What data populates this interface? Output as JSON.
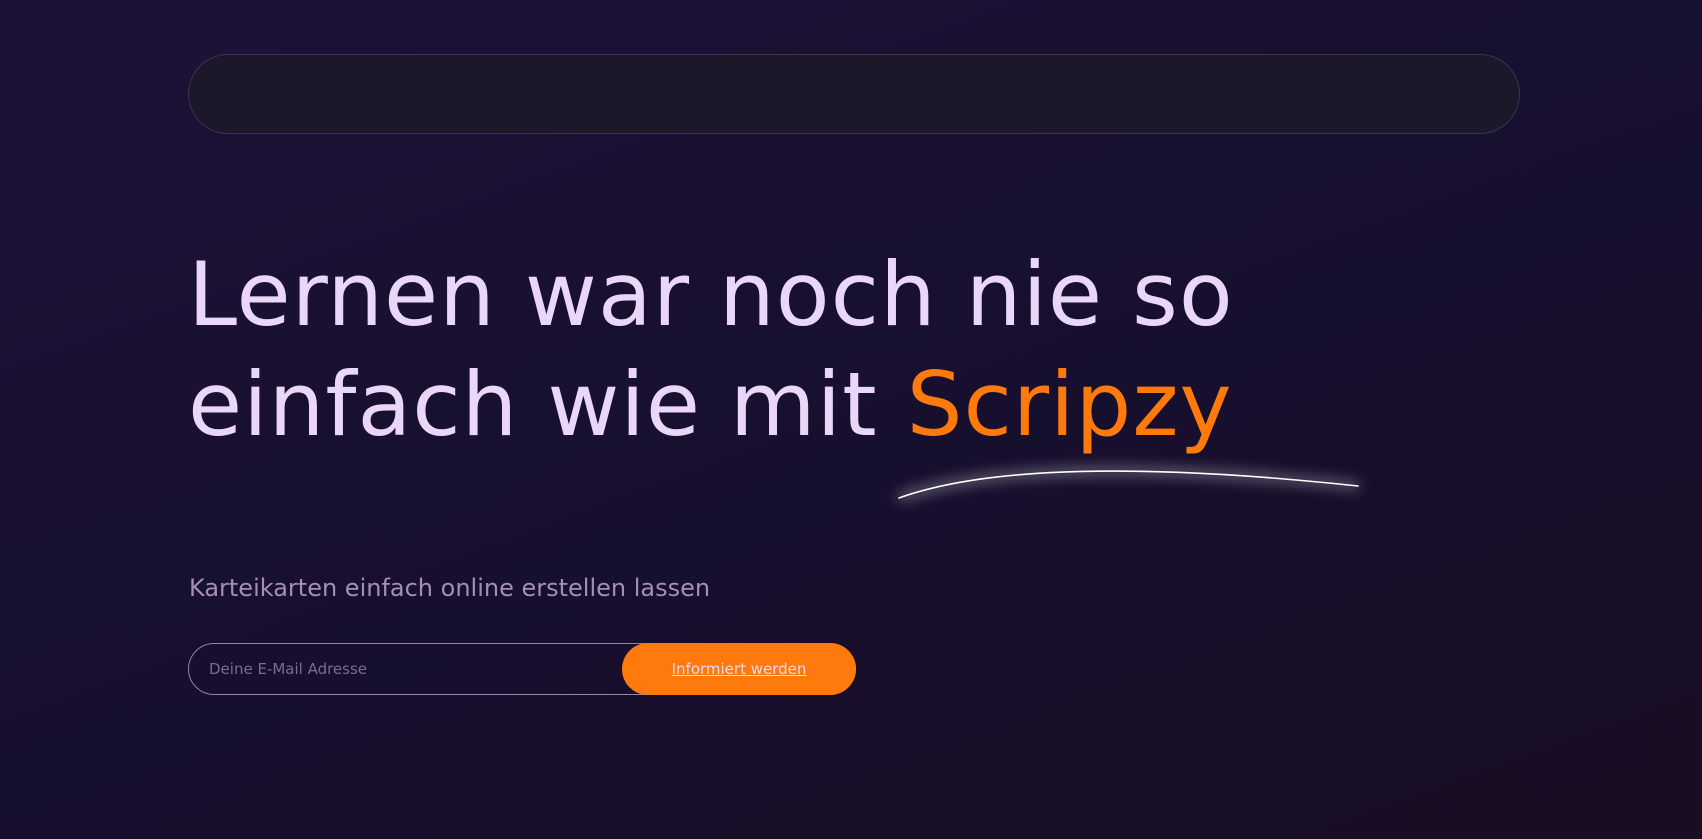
{
  "hero": {
    "headline_line1": "Lernen war noch nie so",
    "headline_line2_prefix": "einfach wie mit ",
    "headline_brand": "Scripzy",
    "subtitle": "Karteikarten einfach online erstellen lassen"
  },
  "signup": {
    "email_placeholder": "Deine E-Mail Adresse",
    "email_value": "",
    "button_label": "Informiert werden"
  },
  "colors": {
    "background": "#1a1133",
    "headline_text": "#ead7f7",
    "brand_accent": "#ff7a0c",
    "subtitle_text": "#a58eb6",
    "navbar_fill": "#1c1829",
    "navbar_border": "#3b3454"
  },
  "icons": {
    "decoration": "underline-swoosh"
  }
}
